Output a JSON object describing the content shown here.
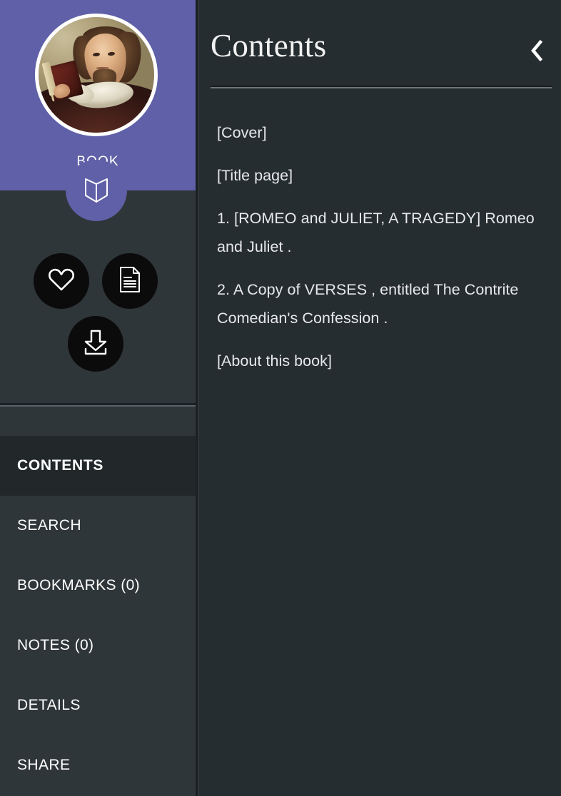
{
  "sidebar": {
    "profile": {
      "label": "BOOK",
      "avatar_icon": "shakespeare-portrait",
      "header_color": "#6060A8"
    },
    "fab": {
      "icon": "open-book-icon",
      "label": "Open book"
    },
    "actions": [
      {
        "name": "favorite",
        "icon": "heart-icon",
        "label": "Favorite"
      },
      {
        "name": "document",
        "icon": "document-icon",
        "label": "Document"
      },
      {
        "name": "download",
        "icon": "download-icon",
        "label": "Download"
      }
    ],
    "menu": [
      {
        "label": "CONTENTS",
        "active": true
      },
      {
        "label": "SEARCH",
        "active": false
      },
      {
        "label": "BOOKMARKS (0)",
        "active": false
      },
      {
        "label": "NOTES (0)",
        "active": false
      },
      {
        "label": "DETAILS",
        "active": false
      },
      {
        "label": "SHARE",
        "active": false
      }
    ]
  },
  "panel": {
    "title": "Contents",
    "collapse_icon": "chevron-left-icon",
    "entries": [
      "[Cover]",
      "[Title page]",
      "1. [ROMEO and JULIET, A TRAGEDY] Romeo and Juliet .",
      "2. A Copy of VERSES , entitled The Contrite Comedian's Confession .",
      "[About this book]"
    ]
  },
  "colors": {
    "accent": "#6060A8",
    "sidebar_bg": "#2F3639",
    "sidebar_active_bg": "#22282A",
    "panel_bg": "#262D31",
    "action_circle_bg": "#0B0B0B",
    "text": "#FFFFFF"
  }
}
